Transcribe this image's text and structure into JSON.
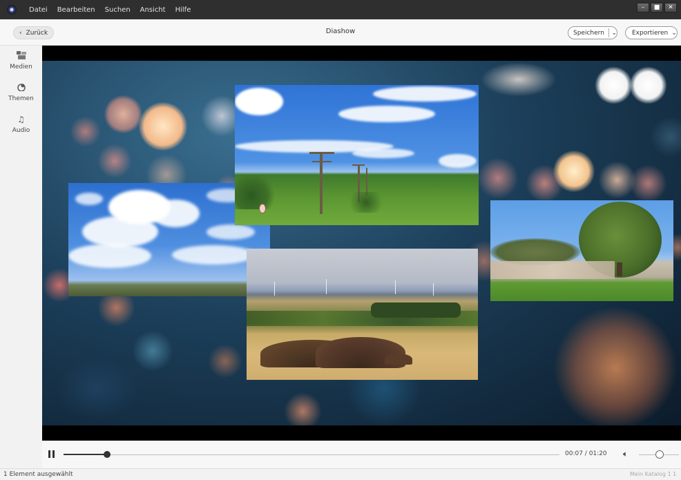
{
  "menubar": {
    "items": [
      "Datei",
      "Bearbeiten",
      "Suchen",
      "Ansicht",
      "Hilfe"
    ],
    "window_controls": {
      "minimize": "–",
      "maximize": "■",
      "close": "✕"
    }
  },
  "toolbar": {
    "back_label": "Zurück",
    "title": "Diashow",
    "save_label": "Speichern",
    "export_label": "Exportieren"
  },
  "sidebar": {
    "items": [
      {
        "label": "Medien",
        "icon": "media-icon"
      },
      {
        "label": "Themen",
        "icon": "themes-icon"
      },
      {
        "label": "Audio",
        "icon": "audio-icon"
      }
    ]
  },
  "player": {
    "time": "00:07 / 01:20",
    "progress": 0.0875,
    "volume": 0.5
  },
  "status": {
    "left": "1 Element ausgewählt",
    "right": "Mein Katalog 1 1"
  },
  "colors": {
    "menubar": "#2f2f2f",
    "canvas_bg": "#000000"
  }
}
